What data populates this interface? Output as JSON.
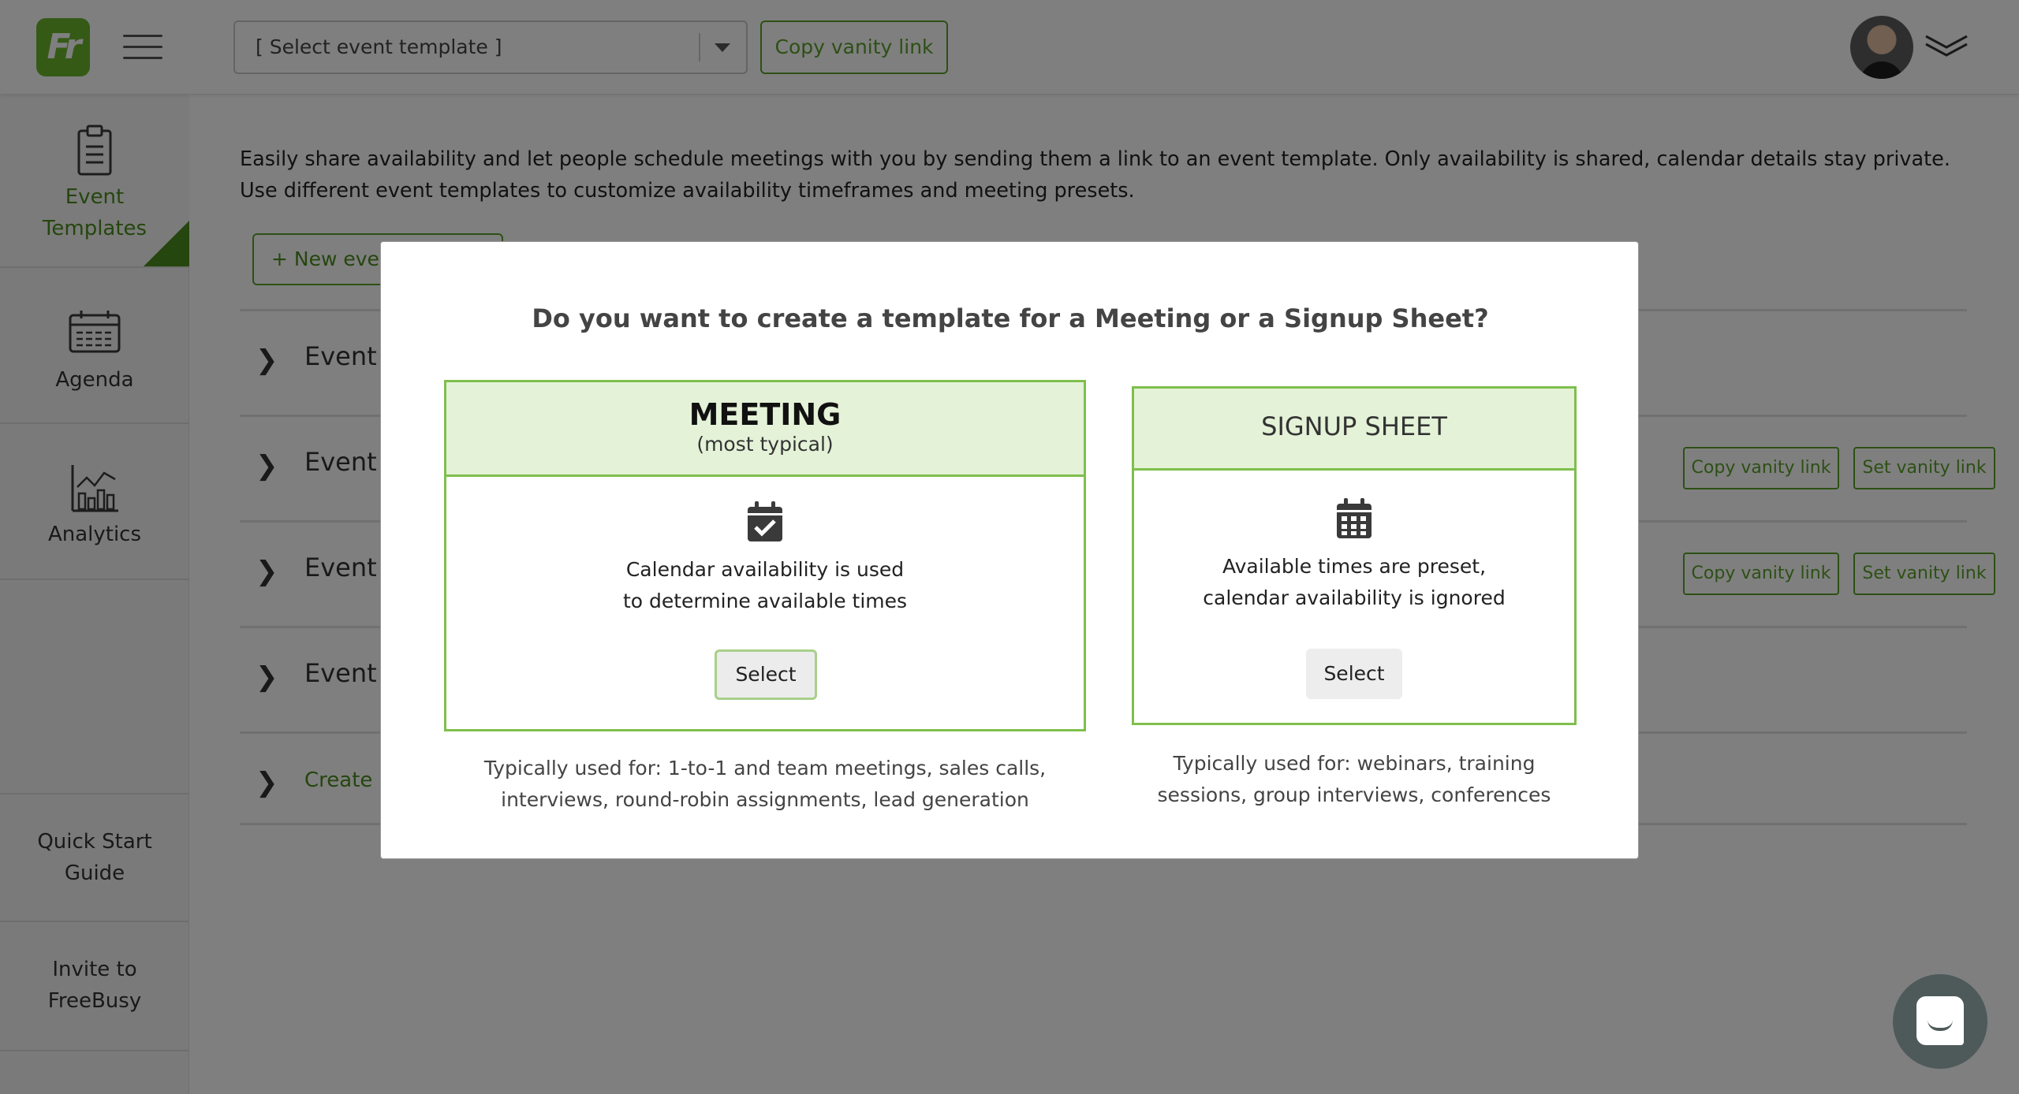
{
  "app": {
    "logo_text": "Fr",
    "brand_color": "#6ab42d",
    "accent_dark": "#4a8c1d"
  },
  "topbar": {
    "template_select": {
      "value": "[ Select event template ]"
    },
    "copy_vanity_label": "Copy vanity link"
  },
  "sidebar": {
    "items": [
      {
        "label_line1": "Event",
        "label_line2": "Templates",
        "icon": "clipboard-icon",
        "active": true
      },
      {
        "label_line1": "Agenda",
        "icon": "calendar-icon"
      },
      {
        "label_line1": "Analytics",
        "icon": "bar-chart-icon"
      },
      {
        "label_line1": "Quick Start",
        "label_line2": "Guide"
      },
      {
        "label_line1": "Invite to",
        "label_line2": "FreeBusy"
      }
    ]
  },
  "main": {
    "intro_line1": "Easily share availability and let people schedule meetings with you by sending them a link to an event template. Only availability is shared, calendar details stay private.",
    "intro_line2": "Use different event templates to customize availability timeframes and meeting presets.",
    "new_button": "+  New even",
    "rows": [
      {
        "name": "Event t"
      },
      {
        "name": "Event t",
        "copy_vanity": "Copy vanity link",
        "set_vanity": "Set vanity link"
      },
      {
        "name": "Event t",
        "copy_vanity": "Copy vanity link",
        "set_vanity": "Set vanity link"
      },
      {
        "name": "Event t"
      },
      {
        "name": "Create n"
      }
    ]
  },
  "modal": {
    "title": "Do you want to create a template for a Meeting or a Signup Sheet?",
    "meeting": {
      "title": "MEETING",
      "subtitle": "(most typical)",
      "icon": "calendar-check-icon",
      "desc_line1": "Calendar availability is used",
      "desc_line2": "to determine available times",
      "select_label": "Select",
      "usage_line1": "Typically used for: 1-to-1 and team meetings, sales calls,",
      "usage_line2": "interviews, round-robin assignments, lead generation"
    },
    "signup": {
      "title": "SIGNUP SHEET",
      "icon": "calendar-grid-icon",
      "desc_line1": "Available times are preset,",
      "desc_line2": "calendar availability is ignored",
      "select_label": "Select",
      "usage_line1": "Typically used for: webinars, training",
      "usage_line2": "sessions, group interviews, conferences"
    }
  }
}
